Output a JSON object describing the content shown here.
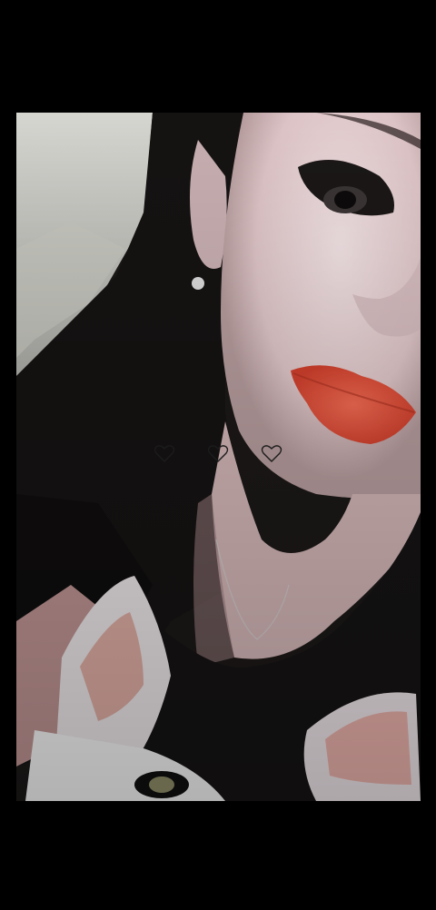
{
  "viewer": {
    "background_color": "#000000",
    "photo_description_icon": "portrait-photo"
  },
  "hearts": [
    {
      "icon": "heart-outline-icon"
    },
    {
      "icon": "heart-outline-icon"
    },
    {
      "icon": "heart-outline-icon"
    }
  ],
  "colors": {
    "heart_stroke": "#1c1c1c",
    "lips": "#e0503a",
    "skin": "#e8d2d3",
    "hair": "#141212"
  }
}
